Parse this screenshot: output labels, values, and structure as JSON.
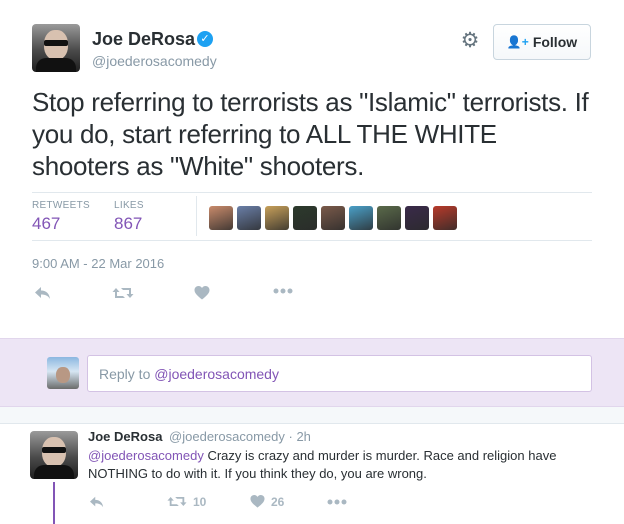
{
  "tweet": {
    "author_name": "Joe DeRosa",
    "verified_icon": "verified-check-icon",
    "handle": "@joederosacomedy",
    "follow_label": "Follow",
    "text": "Stop referring to terrorists as \"Islamic\" terrorists. If you do, start referring to ALL THE WHITE shooters as \"White\" shooters.",
    "stats": {
      "retweets_label": "RETWEETS",
      "retweets": "467",
      "likes_label": "LIKES",
      "likes": "867"
    },
    "liker_avatar_colors": [
      "#c98b6b",
      "#6a7fa8",
      "#c7a05a",
      "#2c3a2c",
      "#7a5a4a",
      "#4aa0c8",
      "#5a6a4a",
      "#3a2a4a",
      "#b83a2a"
    ],
    "timestamp": "9:00 AM - 22 Mar 2016",
    "actions": [
      "reply-icon",
      "retweet-icon",
      "like-icon",
      "more-icon"
    ]
  },
  "reply_box": {
    "placeholder_prefix": "Reply to ",
    "placeholder_mention": "@joederosacomedy"
  },
  "reply_tweet": {
    "author_name": "Joe DeRosa",
    "handle": "@joederosacomedy",
    "time": "· 2h",
    "mention": "@joederosacomedy",
    "text": " Crazy is crazy and murder is murder. Race and religion have NOTHING to do with it. If you think they do, you are wrong.",
    "retweets": "10",
    "likes": "26"
  },
  "colors": {
    "accent": "#8255b6",
    "verified": "#1da1f2",
    "muted": "#8899a6",
    "reply_band": "#ede5f5"
  }
}
